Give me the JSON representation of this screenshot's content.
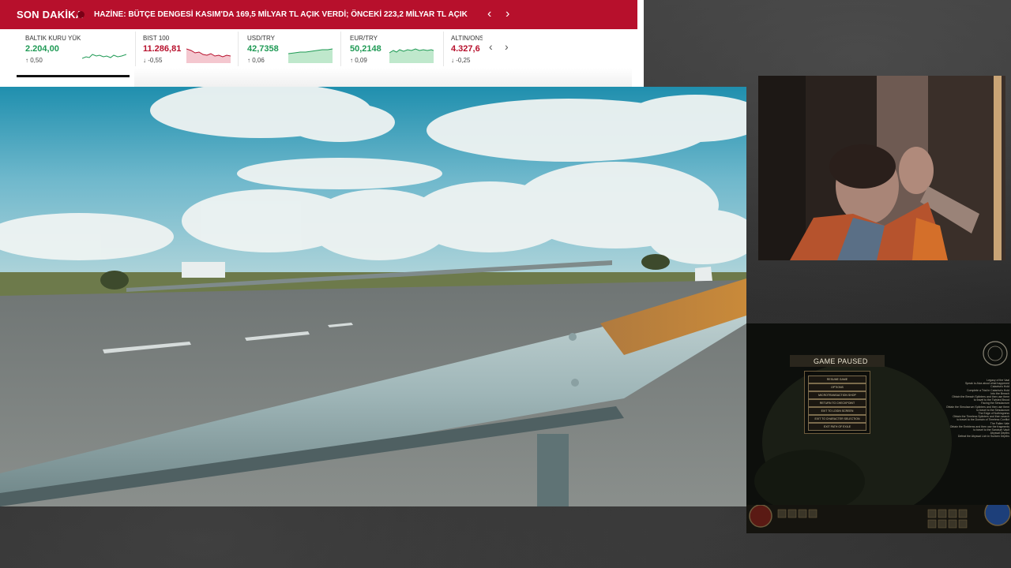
{
  "news": {
    "breaking_label": "SON DAKİKA",
    "headline": "HAZİNE: BÜTÇE DENGESİ KASIM'DA 169,5 MİLYAR TL AÇIK VERDİ; ÖNCEKİ 223,2 MİLYAR TL AÇIK",
    "prev": "‹",
    "next": "›",
    "markets": [
      {
        "name": "BALTIK KURU YÜK",
        "value": "2.204,00",
        "change": "↑ 0,50",
        "direction": "up"
      },
      {
        "name": "BIST 100",
        "value": "11.286,81",
        "change": "↓ -0,55",
        "direction": "down"
      },
      {
        "name": "USD/TRY",
        "value": "42,7358",
        "change": "↑ 0,06",
        "direction": "up"
      },
      {
        "name": "EUR/TRY",
        "value": "50,2148",
        "change": "↑ 0,09",
        "direction": "up"
      },
      {
        "name": "ALTIN/ONS",
        "value": "4.327,6",
        "change": "↓ -0,25",
        "direction": "down"
      }
    ],
    "colors": {
      "brand": "#b7102c",
      "up": "#1f9a55",
      "down": "#b7102c"
    }
  },
  "game": {
    "title": "GAME PAUSED",
    "menu": [
      "RESUME GAME",
      "OPTIONS",
      "MICROTRANSACTION SHOP",
      "RETURN TO CHECKPOINT",
      "EXIT TO LOGIN SCREEN",
      "EXIT TO CHARACTER SELECTION",
      "EXIT PATH OF EXILE"
    ],
    "quests": [
      "Legacy of the Vaal",
      "Speak to Alva about what happened",
      "Catarina's Hold",
      "Complete a Trial in Catarina's Hold",
      "Into the Breach",
      "Obtain the Breach Splinters and then use them",
      "to travel to the Twisted Brood",
      "Facing the Simulacrum",
      "Obtain the Simulacrum Splinters and then use them",
      "to travel to the Simulacrum",
      "The Edge of Nothingness",
      "Obtain the Timeless Splinters and then search",
      "to travel to the Domain of Timeless Conflict",
      "The Fallen Vale",
      "Obtain the Emblems and then use the fragments",
      "to travel to the Sanctum Vault",
      "Abyssal Depths",
      "Defeat the Abyssal Lich in Sunken Depths"
    ]
  }
}
